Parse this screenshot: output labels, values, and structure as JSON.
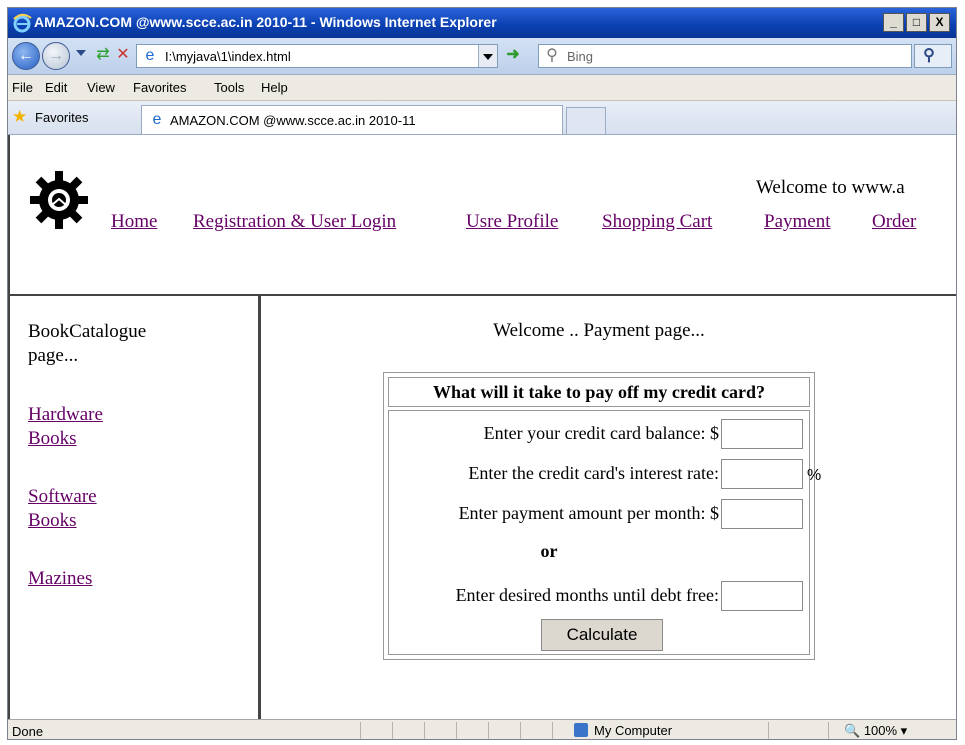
{
  "window": {
    "title": "AMAZON.COM @www.scce.ac.in 2010-11 - Windows Internet Explorer",
    "controls": [
      "_",
      "□",
      "X"
    ]
  },
  "address_bar": {
    "url": "I:\\myjava\\1\\index.html",
    "search_placeholder": "Bing"
  },
  "menu": [
    "File",
    "Edit",
    "View",
    "Favorites",
    "Tools",
    "Help"
  ],
  "favorites": {
    "label": "Favorites",
    "tab_title": "AMAZON.COM @www.scce.ac.in 2010-11"
  },
  "header": {
    "welcome": "Welcome to www.a",
    "nav": [
      "Home",
      "Registration & User Login",
      "Usre Profile",
      "Shopping Cart",
      "Payment",
      "Order"
    ]
  },
  "sidebar": {
    "title": "BookCatalogue page...",
    "links": [
      "Hardware Books",
      "Software Books",
      "Mazines"
    ]
  },
  "main": {
    "welcome": "Welcome .. Payment page...",
    "calculator": {
      "heading": "What will it take to pay off my credit card?",
      "balance_label": "Enter your credit card balance: $",
      "rate_label": "Enter the credit card's interest rate:",
      "rate_suffix": "%",
      "payment_label": "Enter payment amount per month: $",
      "or_label": "or",
      "months_label": "Enter desired months until debt free:",
      "button_label": "Calculate"
    }
  },
  "status": {
    "left": "Done",
    "zone": "My Computer",
    "zoom": "100%"
  },
  "colors": {
    "titlebar": "#0a3fb0",
    "link": "#660066"
  }
}
